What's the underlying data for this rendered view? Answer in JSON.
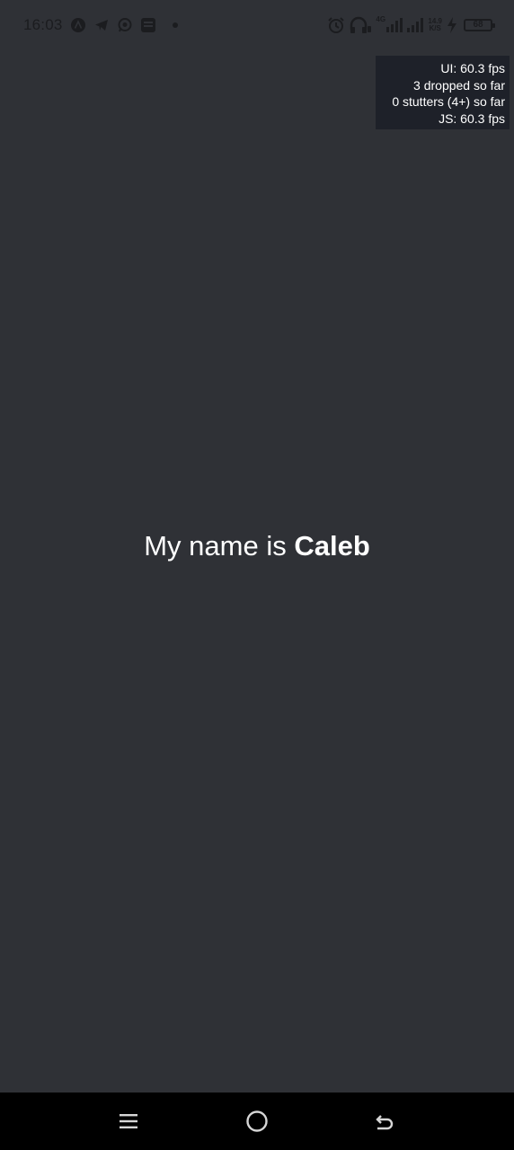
{
  "status_bar": {
    "time": "16:03",
    "left_icons": [
      "app-logo-icon",
      "telegram-icon",
      "whatsapp-icon",
      "app-square-icon",
      "dot-icon"
    ],
    "right_icons": [
      "alarm-icon",
      "headphones-icon",
      "signal-4g-icon",
      "signal-icon",
      "net-speed",
      "charging-icon",
      "battery-icon"
    ],
    "network_type": "4G",
    "net_speed_value": "14.9",
    "net_speed_unit": "K/S",
    "battery_level": "68",
    "icon_color": "#1b1c1f"
  },
  "perf_monitor": {
    "ui_fps": "UI: 60.3 fps",
    "dropped": "3 dropped so far",
    "stutters": "0 stutters (4+) so far",
    "js_fps": "JS: 60.3 fps"
  },
  "main": {
    "greeting_prefix": "My name is ",
    "name": "Caleb",
    "background_color": "#2f3136"
  },
  "nav_bar": {
    "buttons": [
      "menu-icon",
      "home-icon",
      "back-icon"
    ]
  }
}
